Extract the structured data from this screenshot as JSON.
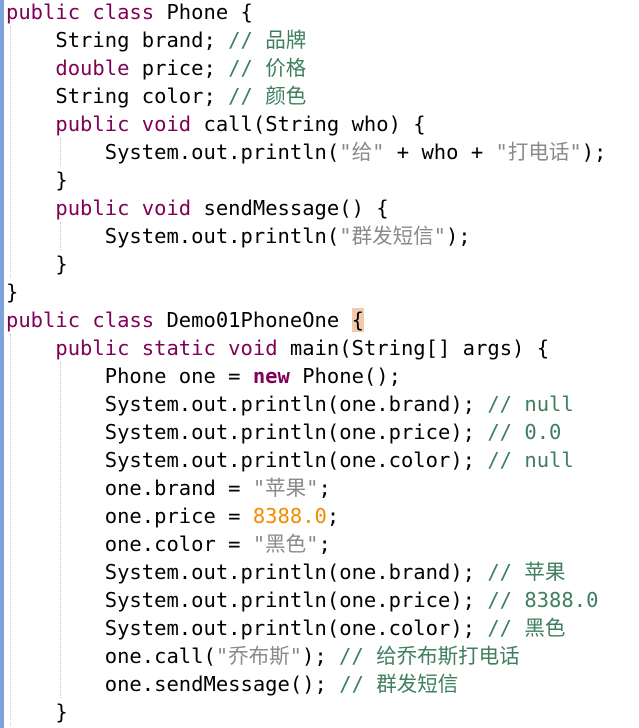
{
  "editor": {
    "accent_colors": {
      "keyword": "#7f0055",
      "string": "#2a00ff",
      "comment": "#3f7f5f",
      "number": "#f28c00",
      "brace_highlight": "#f2c9ad",
      "gutter": "#7fa3d8"
    },
    "lines": [
      [
        {
          "t": "public class",
          "c": "kw"
        },
        {
          "t": " Phone {",
          "c": ""
        }
      ],
      [
        {
          "t": "    String brand; ",
          "c": ""
        },
        {
          "t": "// 品牌",
          "c": "cm"
        }
      ],
      [
        {
          "t": "    ",
          "c": ""
        },
        {
          "t": "double",
          "c": "kw"
        },
        {
          "t": " price; ",
          "c": ""
        },
        {
          "t": "// 价格",
          "c": "cm"
        }
      ],
      [
        {
          "t": "    String color; ",
          "c": ""
        },
        {
          "t": "// 颜色",
          "c": "cm"
        }
      ],
      [
        {
          "t": "    ",
          "c": ""
        },
        {
          "t": "public void",
          "c": "kw"
        },
        {
          "t": " call(String who) {",
          "c": ""
        }
      ],
      [
        {
          "t": "        System.out.println(",
          "c": ""
        },
        {
          "t": "\"给\"",
          "c": "strcn"
        },
        {
          "t": " + who + ",
          "c": ""
        },
        {
          "t": "\"打电话\"",
          "c": "strcn"
        },
        {
          "t": ");",
          "c": ""
        }
      ],
      [
        {
          "t": "    }",
          "c": ""
        }
      ],
      [
        {
          "t": "    ",
          "c": ""
        },
        {
          "t": "public void",
          "c": "kw"
        },
        {
          "t": " sendMessage() {",
          "c": ""
        }
      ],
      [
        {
          "t": "        System.out.println(",
          "c": ""
        },
        {
          "t": "\"群发短信\"",
          "c": "strcn"
        },
        {
          "t": ");",
          "c": ""
        }
      ],
      [
        {
          "t": "    }",
          "c": ""
        }
      ],
      [
        {
          "t": "}",
          "c": ""
        }
      ],
      [
        {
          "t": "public class",
          "c": "kw"
        },
        {
          "t": " Demo01PhoneOne ",
          "c": ""
        },
        {
          "t": "{",
          "c": "bracematch"
        }
      ],
      [
        {
          "t": "    ",
          "c": ""
        },
        {
          "t": "public static void",
          "c": "kw"
        },
        {
          "t": " main(String[] args) {",
          "c": ""
        }
      ],
      [
        {
          "t": "        Phone one = ",
          "c": ""
        },
        {
          "t": "new",
          "c": "kw bold"
        },
        {
          "t": " Phone();",
          "c": ""
        }
      ],
      [
        {
          "t": "        System.out.println(one.brand); ",
          "c": ""
        },
        {
          "t": "// null",
          "c": "cm"
        }
      ],
      [
        {
          "t": "        System.out.println(one.price); ",
          "c": ""
        },
        {
          "t": "// 0.0",
          "c": "cm"
        }
      ],
      [
        {
          "t": "        System.out.println(one.color); ",
          "c": ""
        },
        {
          "t": "// null",
          "c": "cm"
        }
      ],
      [
        {
          "t": "        one.brand = ",
          "c": ""
        },
        {
          "t": "\"苹果\"",
          "c": "strcn"
        },
        {
          "t": ";",
          "c": ""
        }
      ],
      [
        {
          "t": "        one.price = ",
          "c": ""
        },
        {
          "t": "8388.0",
          "c": "num"
        },
        {
          "t": ";",
          "c": ""
        }
      ],
      [
        {
          "t": "        one.color = ",
          "c": ""
        },
        {
          "t": "\"黑色\"",
          "c": "strcn"
        },
        {
          "t": ";",
          "c": ""
        }
      ],
      [
        {
          "t": "        System.out.println(one.brand); ",
          "c": ""
        },
        {
          "t": "// 苹果",
          "c": "cm"
        }
      ],
      [
        {
          "t": "        System.out.println(one.price); ",
          "c": ""
        },
        {
          "t": "// 8388.0",
          "c": "cm"
        }
      ],
      [
        {
          "t": "        System.out.println(one.color); ",
          "c": ""
        },
        {
          "t": "// 黑色",
          "c": "cm"
        }
      ],
      [
        {
          "t": "        one.call(",
          "c": ""
        },
        {
          "t": "\"乔布斯\"",
          "c": "strcn"
        },
        {
          "t": "); ",
          "c": ""
        },
        {
          "t": "// 给乔布斯打电话",
          "c": "cm"
        }
      ],
      [
        {
          "t": "        one.sendMessage(); ",
          "c": ""
        },
        {
          "t": "// 群发短信",
          "c": "cm"
        }
      ],
      [
        {
          "t": "    }",
          "c": ""
        }
      ]
    ]
  }
}
